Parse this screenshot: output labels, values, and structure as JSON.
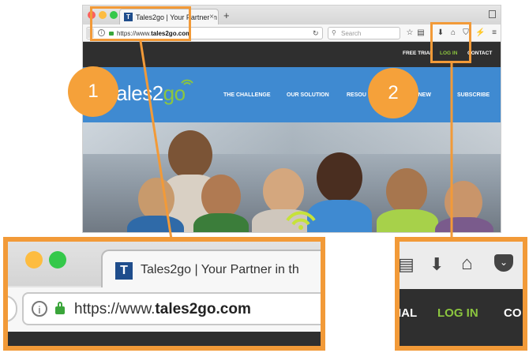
{
  "browser": {
    "tab_title": "Tales2go | Your Partner in th",
    "tab_close": "×",
    "new_tab": "+",
    "url": "https://www.tales2go.com",
    "url_prefix": "https://www.",
    "url_domain": "tales2go.com",
    "search_placeholder": "Search",
    "favicon_letter": "T"
  },
  "site": {
    "top_links": [
      "FREE TRIAL",
      "LOG IN",
      "CONTACT"
    ],
    "logo_prefix": "ales2",
    "logo_suffix": "go",
    "nav_links": [
      "THE CHALLENGE",
      "OUR SOLUTION",
      "RESOU",
      "S NEW",
      "SUBSCRIBE"
    ]
  },
  "callouts": {
    "one": "1",
    "two": "2"
  },
  "zoom1": {
    "tab_title": "Tales2go | Your Partner in th",
    "url_prefix": "https://www.",
    "url_domain": "tales2go.com"
  },
  "zoom2": {
    "left_link": "IAL",
    "login": "LOG IN",
    "right_link": "CO"
  },
  "colors": {
    "callout": "#f5a13a",
    "site_blue": "#3f8ad1",
    "login_green": "#8cc63f",
    "dark_bar": "#2f2f2f"
  }
}
